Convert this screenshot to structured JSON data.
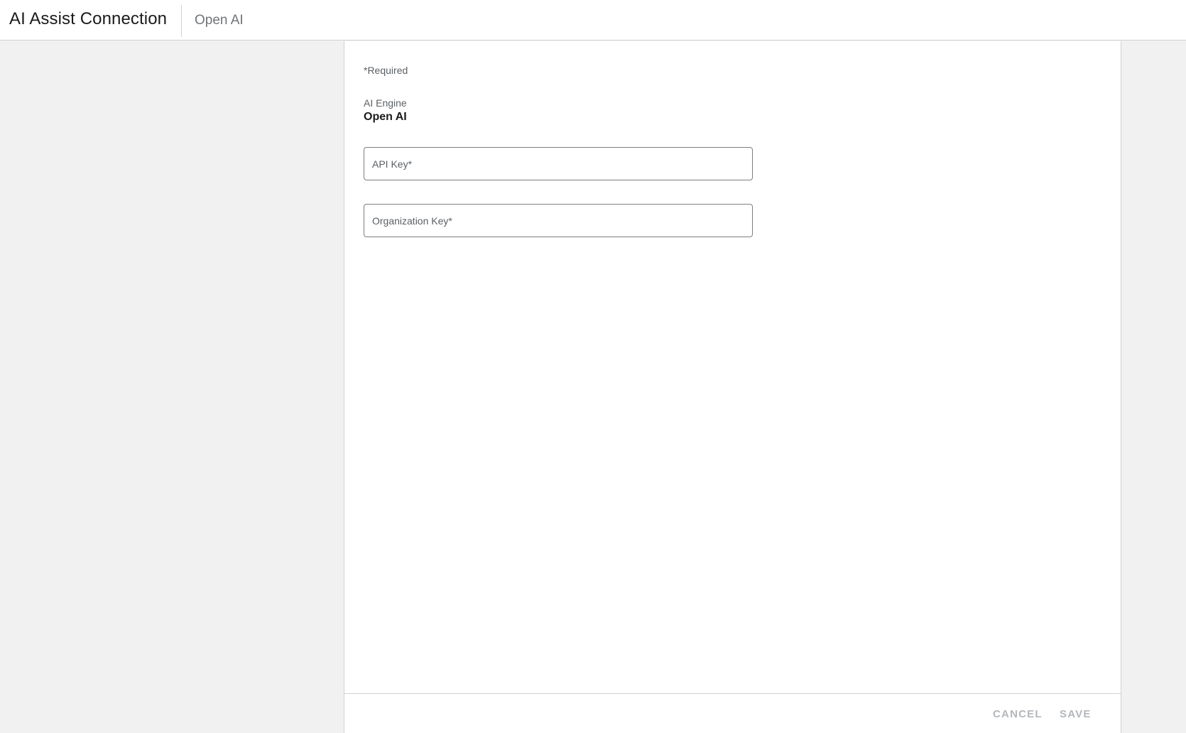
{
  "header": {
    "title": "AI Assist Connection",
    "subtitle": "Open AI"
  },
  "form": {
    "required_note": "*Required",
    "engine_label": "AI Engine",
    "engine_value": "Open AI",
    "api_key": {
      "placeholder": "API Key*",
      "value": ""
    },
    "organization_key": {
      "placeholder": "Organization Key*",
      "value": ""
    }
  },
  "footer": {
    "cancel_label": "CANCEL",
    "save_label": "SAVE"
  },
  "colors": {
    "background": "#f0f1f0",
    "panel": "#ffffff",
    "border": "#cfd2d3",
    "disabled_button_text": "#b3b7bb"
  }
}
